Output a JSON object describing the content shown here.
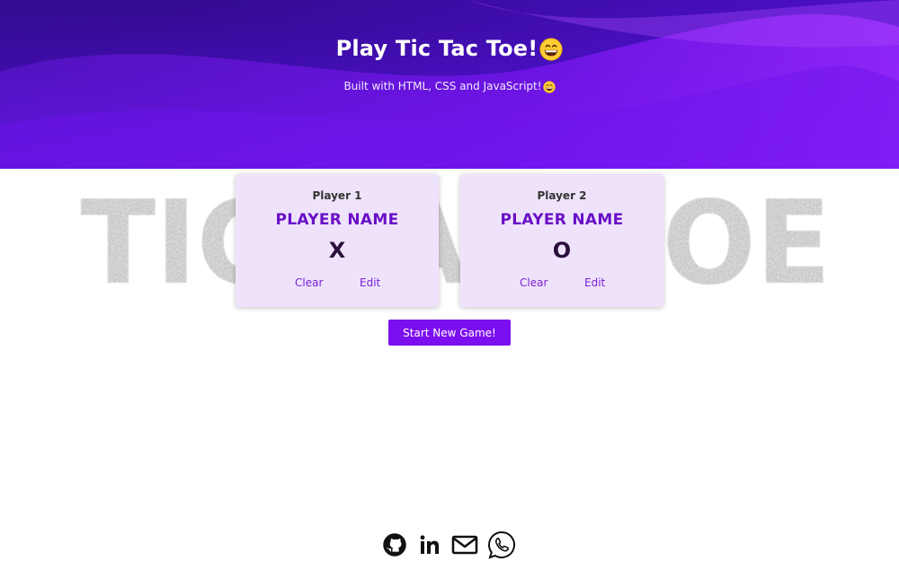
{
  "header": {
    "title": "Play Tic Tac Toe!",
    "subtitle": "Built with HTML, CSS and JavaScript!",
    "emoji_icon": "grinning-face-icon"
  },
  "background_logo": {
    "text": "TIC TAC TOE"
  },
  "players": [
    {
      "label": "Player 1",
      "name": "PLAYER NAME",
      "symbol": "X",
      "clear_label": "Clear",
      "edit_label": "Edit"
    },
    {
      "label": "Player 2",
      "name": "PLAYER NAME",
      "symbol": "O",
      "clear_label": "Clear",
      "edit_label": "Edit"
    }
  ],
  "start_button": {
    "label": "Start New Game!"
  },
  "footer": {
    "icons": [
      "github-icon",
      "linkedin-icon",
      "mail-icon",
      "whatsapp-icon"
    ]
  },
  "colors": {
    "accent": "#7c0ff0",
    "player_name": "#6a0fc7",
    "card_bg": "#efe3fb"
  }
}
